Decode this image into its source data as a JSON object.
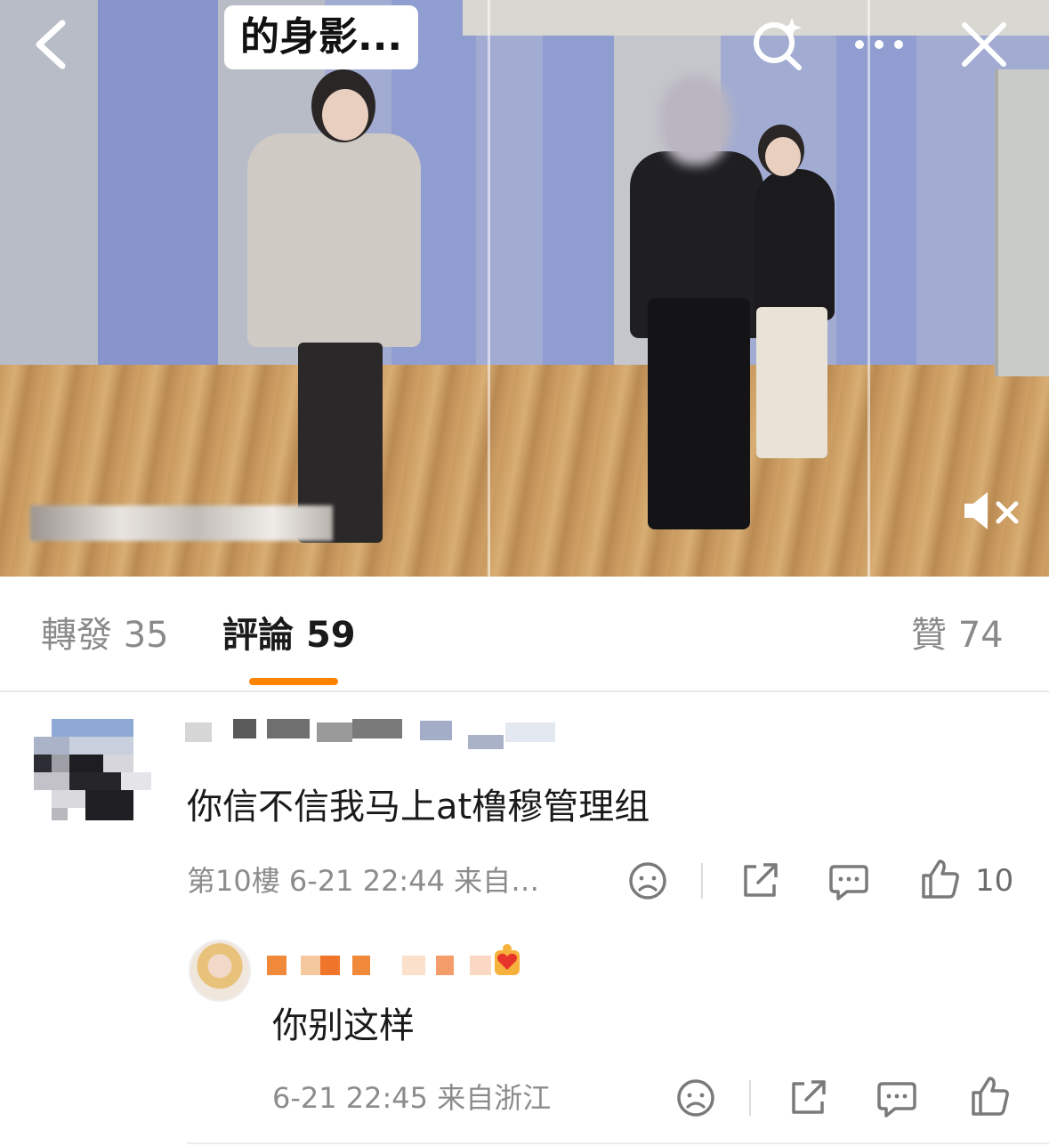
{
  "video": {
    "title_overlay": "的身影...",
    "icons": {
      "back": "chevron-left-icon",
      "search": "search-sparkle-icon",
      "more": "more-dots-icon",
      "close": "close-icon",
      "mute": "muted-speaker-icon"
    }
  },
  "tabs": [
    {
      "label": "轉發",
      "count": "35"
    },
    {
      "label": "評論",
      "count": "59",
      "active": true
    },
    {
      "label": "贊",
      "count": "74"
    }
  ],
  "accent_color": "#ff8200",
  "comments": [
    {
      "text": "你信不信我马上at橹穆管理组",
      "floor": "第10樓",
      "time": "6-21 22:44",
      "source": "来自…",
      "likes": "10"
    }
  ],
  "replies": [
    {
      "text": "你别这样",
      "time": "6-21 22:45",
      "source": "来自浙江"
    }
  ]
}
